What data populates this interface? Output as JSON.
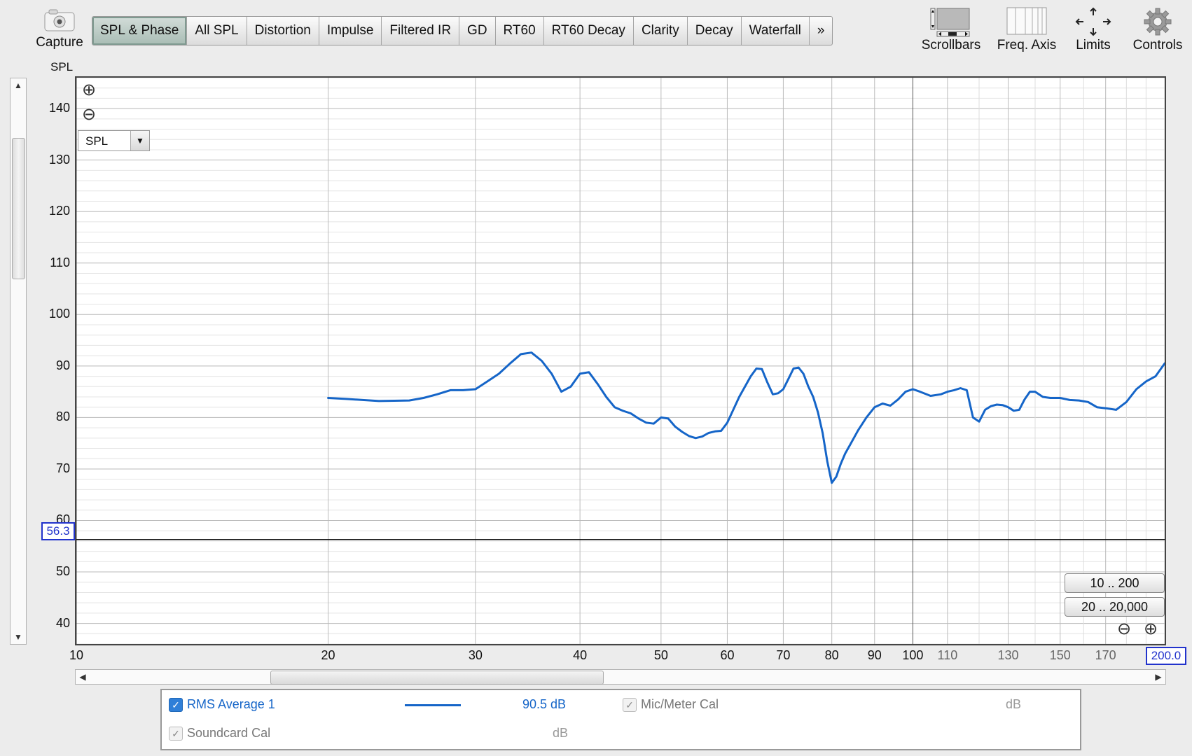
{
  "toolbar": {
    "capture_label": "Capture",
    "tabs": [
      "SPL & Phase",
      "All SPL",
      "Distortion",
      "Impulse",
      "Filtered IR",
      "GD",
      "RT60",
      "RT60 Decay",
      "Clarity",
      "Decay",
      "Waterfall",
      "»"
    ],
    "active_tab": "SPL & Phase",
    "scrollbars_label": "Scrollbars",
    "freq_axis_label": "Freq. Axis",
    "limits_label": "Limits",
    "controls_label": "Controls"
  },
  "plot": {
    "y_axis_title": "SPL",
    "y_selector": "SPL",
    "y_cursor_value": "56.3",
    "x_cursor_value": "200.0",
    "range_buttons": [
      "10 .. 200",
      "20 .. 20,000"
    ]
  },
  "legend": {
    "rms_label": "RMS Average 1",
    "rms_value": "90.5 dB",
    "mic_label": "Mic/Meter Cal",
    "mic_unit": "dB",
    "soundcard_label": "Soundcard Cal",
    "soundcard_unit": "dB"
  },
  "colors": {
    "trace": "#1565c8",
    "cursor_box": "#2233cc",
    "active_tab": "#a8bcb4"
  },
  "chart_data": {
    "type": "line",
    "x_scale": "log",
    "xlim": [
      10,
      200
    ],
    "ylim": [
      36,
      146
    ],
    "y_ticks": [
      40,
      50,
      60,
      70,
      80,
      90,
      100,
      110,
      120,
      130,
      140
    ],
    "x_ticks_major": [
      "10",
      "20",
      "30",
      "40",
      "50",
      "60",
      "70",
      "80",
      "90",
      "100"
    ],
    "x_ticks_minor": [
      "110",
      "130",
      "150",
      "170"
    ],
    "cursor_y": 56.3,
    "series": [
      {
        "name": "RMS Average 1",
        "x": [
          20,
          21,
          23,
          25,
          26,
          27,
          28,
          29,
          30,
          31,
          32,
          33,
          34,
          35,
          36,
          37,
          38,
          39,
          40,
          41,
          42,
          43,
          44,
          45,
          46,
          47,
          48,
          49,
          50,
          51,
          52,
          53,
          54,
          55,
          56,
          57,
          58,
          59,
          60,
          62,
          64,
          65,
          66,
          67,
          68,
          69,
          70,
          71,
          72,
          73,
          74,
          75,
          76,
          77,
          78,
          79,
          80,
          81,
          82,
          83,
          84,
          86,
          88,
          90,
          92,
          94,
          96,
          98,
          100,
          102,
          105,
          108,
          110,
          112,
          114,
          116,
          118,
          120,
          122,
          124,
          126,
          128,
          130,
          132,
          134,
          136,
          138,
          140,
          143,
          146,
          150,
          154,
          158,
          162,
          166,
          170,
          175,
          180,
          185,
          190,
          195,
          200
        ],
        "y": [
          83.8,
          83.6,
          83.2,
          83.3,
          83.8,
          84.5,
          85.3,
          85.3,
          85.5,
          87.0,
          88.5,
          90.5,
          92.3,
          92.6,
          91.0,
          88.5,
          85.0,
          86.0,
          88.5,
          88.8,
          86.5,
          84.0,
          82.0,
          81.3,
          80.8,
          79.8,
          79.0,
          78.8,
          80.0,
          79.8,
          78.2,
          77.2,
          76.4,
          76.0,
          76.3,
          77.0,
          77.3,
          77.4,
          79.0,
          84.0,
          88.0,
          89.5,
          89.4,
          86.8,
          84.5,
          84.7,
          85.5,
          87.5,
          89.5,
          89.7,
          88.5,
          86.0,
          84.0,
          81.0,
          77.0,
          71.5,
          67.3,
          68.5,
          71.0,
          73.0,
          74.5,
          77.5,
          80.0,
          82.0,
          82.7,
          82.3,
          83.5,
          85.0,
          85.5,
          85.0,
          84.2,
          84.5,
          85.0,
          85.3,
          85.7,
          85.3,
          80.0,
          79.2,
          81.5,
          82.2,
          82.5,
          82.4,
          82.0,
          81.3,
          81.5,
          83.5,
          85.0,
          85.0,
          84.0,
          83.8,
          83.8,
          83.4,
          83.3,
          83.0,
          82.0,
          81.8,
          81.5,
          83.0,
          85.5,
          87.0,
          88.0,
          90.5
        ]
      }
    ]
  }
}
